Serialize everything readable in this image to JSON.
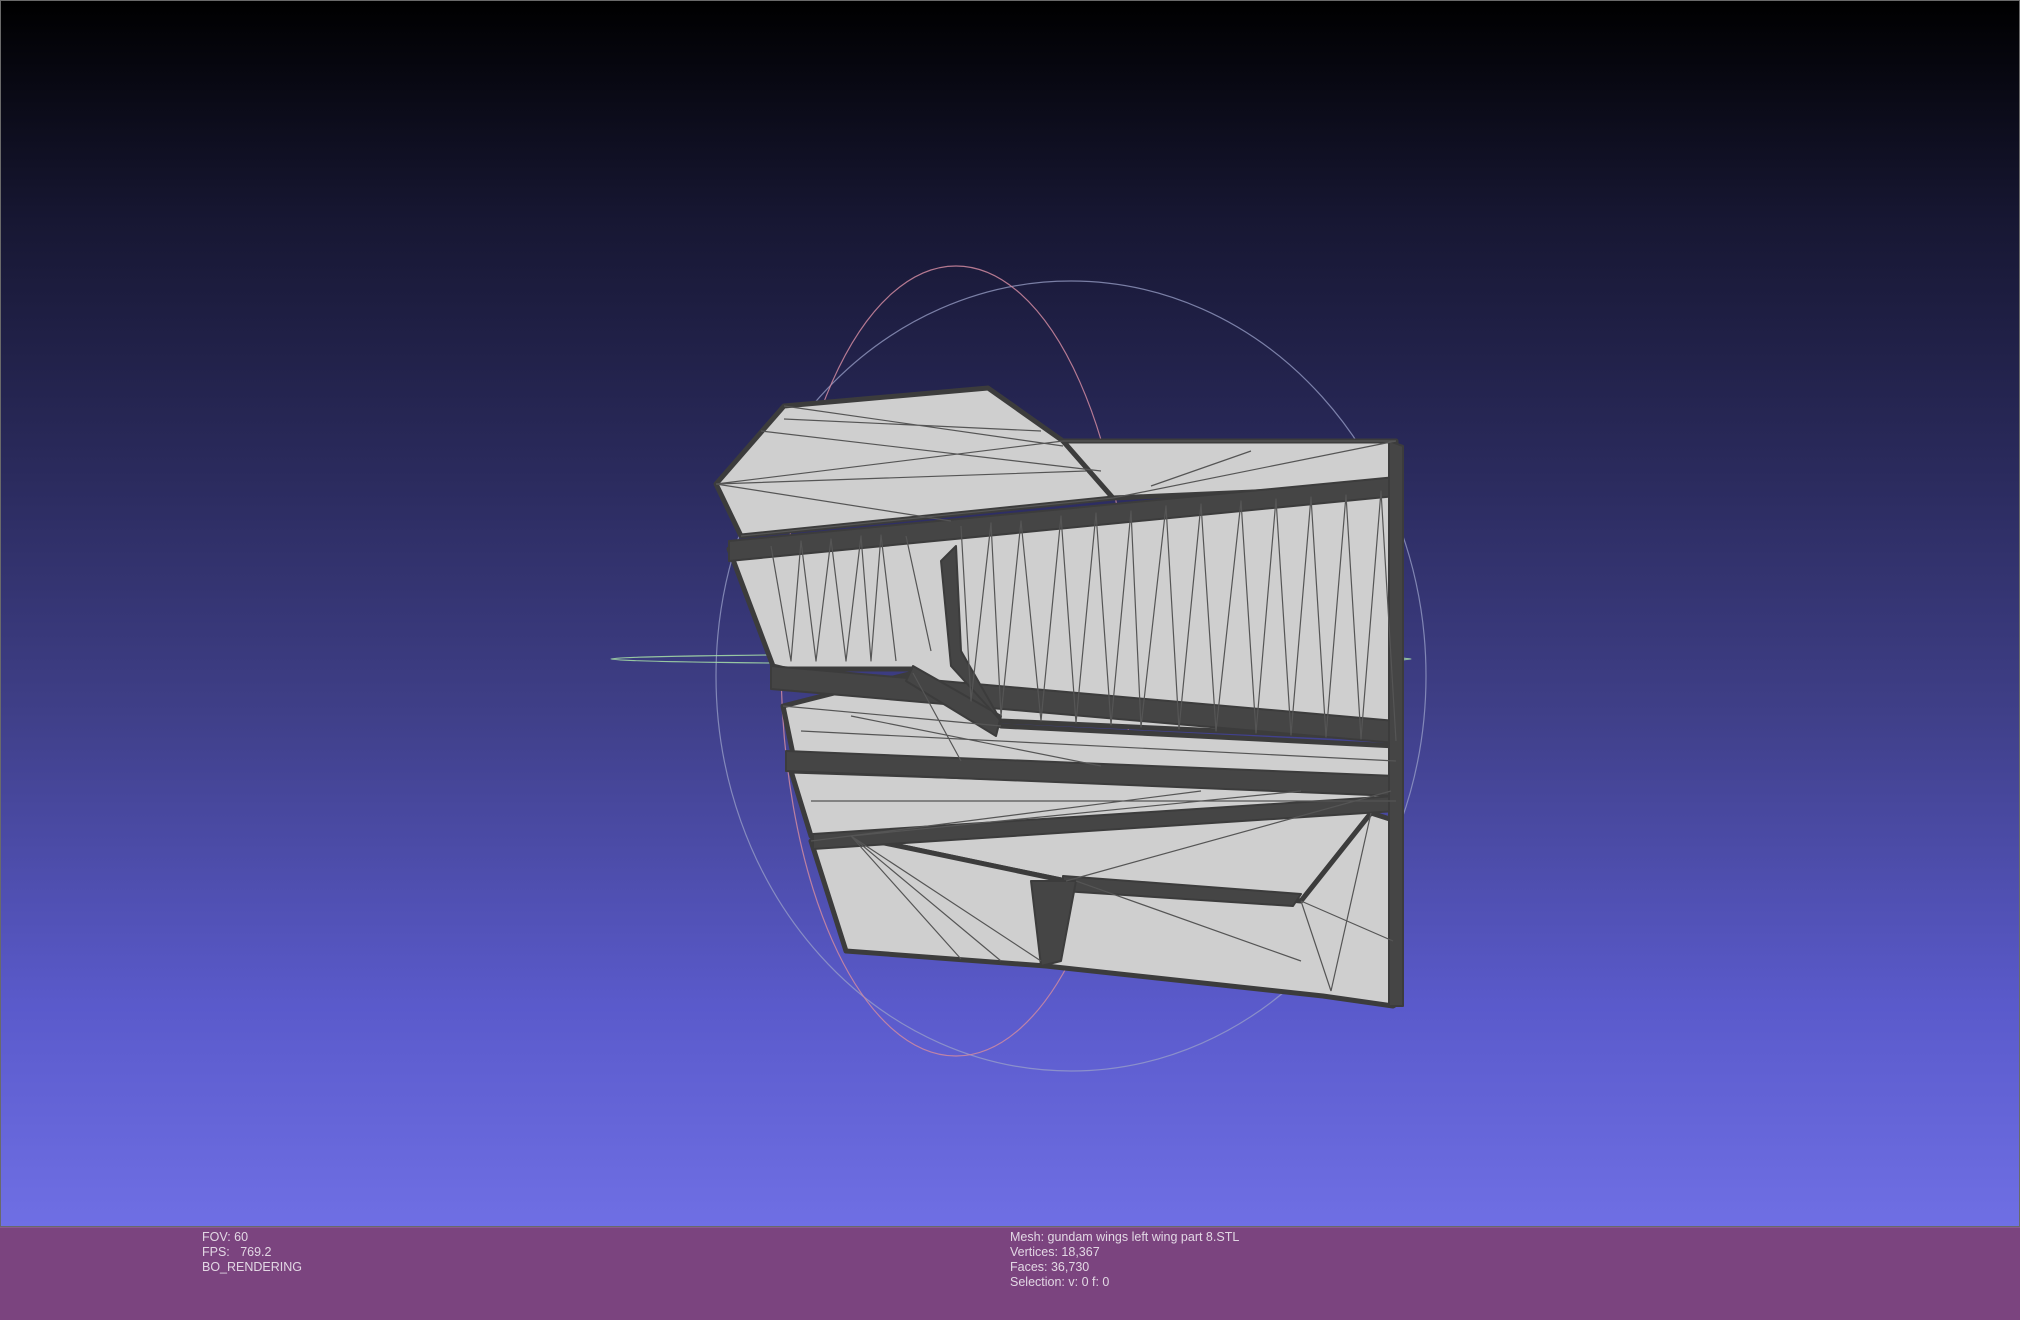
{
  "viewer": {
    "background_top": "#000000",
    "background_bottom": "#6f6fe4",
    "info_bar_color": "#7b447f",
    "mesh_fill_color": "#cfcfcf",
    "mesh_edge_color": "#3c3c3c",
    "trackball_colors": [
      "#d08aa0",
      "#9aa0c8",
      "#a8e0a8"
    ]
  },
  "info_left": {
    "fov": "FOV: 60",
    "fps": "FPS:   769.2",
    "mode": "BO_RENDERING"
  },
  "info_right": {
    "mesh": "Mesh: gundam wings left wing part 8.STL",
    "vertices": "Vertices: 18,367",
    "faces": "Faces: 36,730",
    "selection": "Selection: v: 0 f: 0"
  }
}
